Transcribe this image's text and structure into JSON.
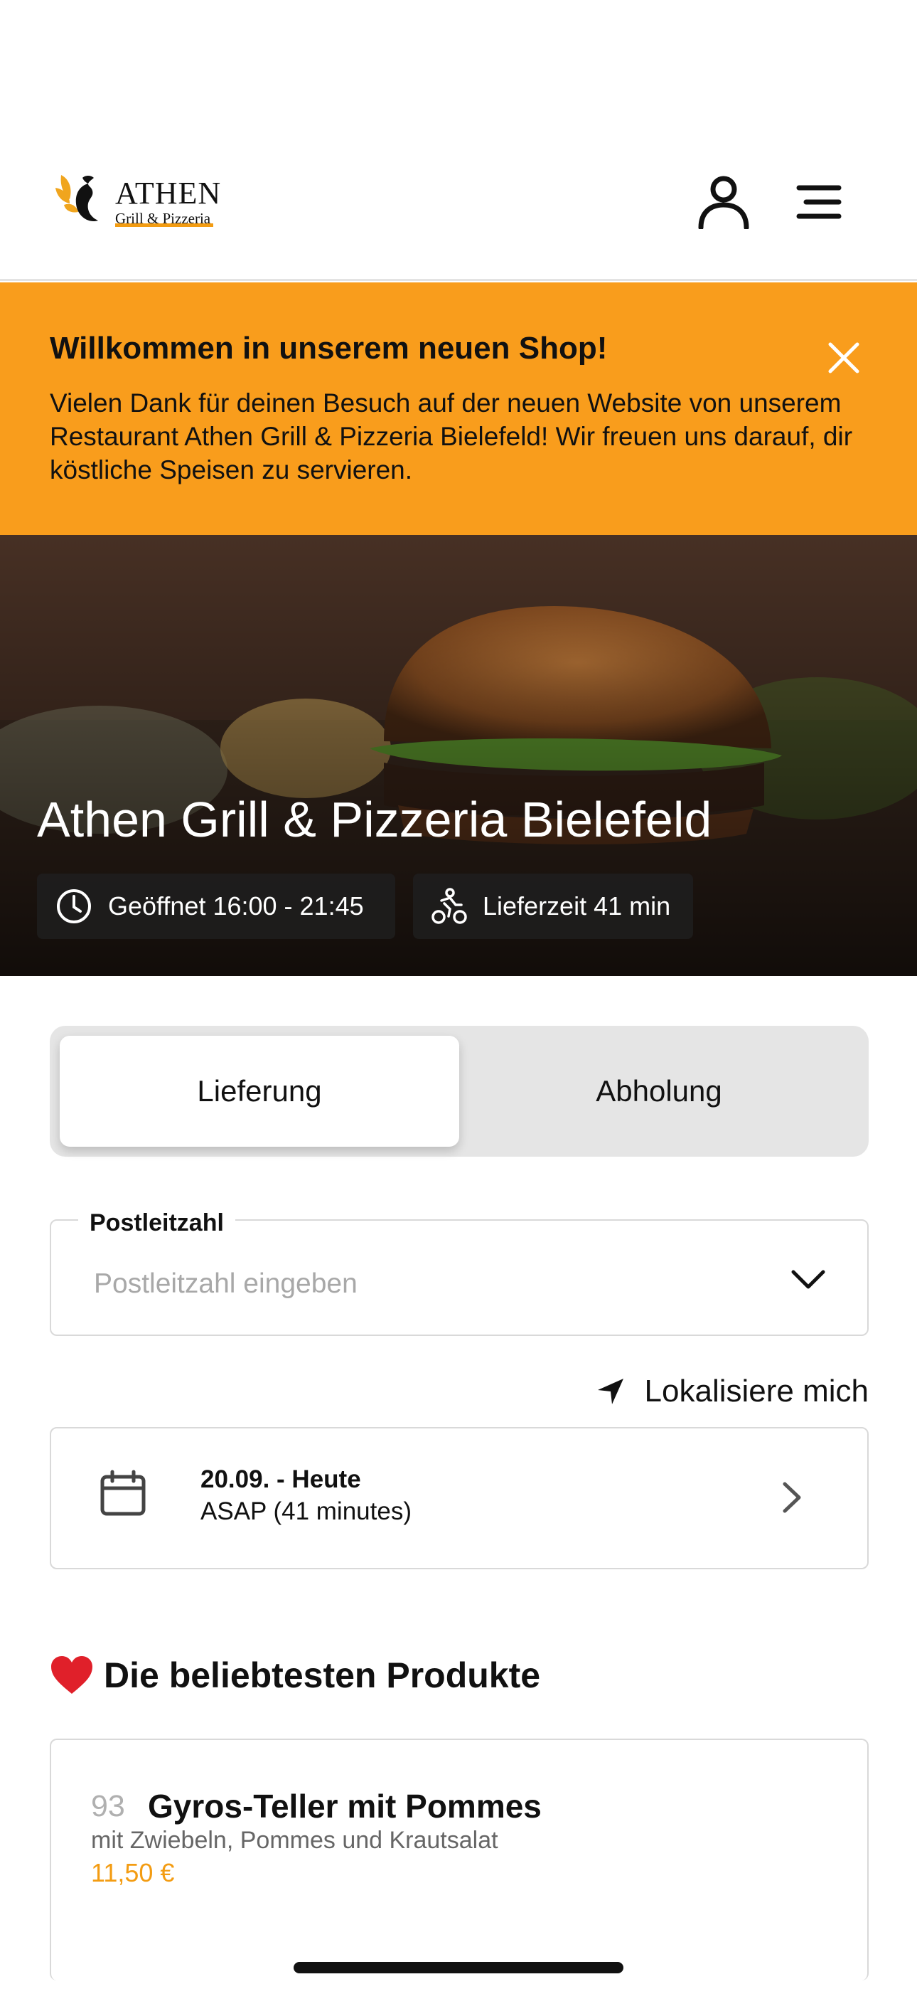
{
  "header": {
    "logo": {
      "main": "ATHEN",
      "sub": "Grill & Pizzeria"
    },
    "icons": {
      "account": "user-icon",
      "menu": "hamburger-menu-icon"
    }
  },
  "banner": {
    "title": "Willkommen in unserem neuen Shop!",
    "text": "Vielen Dank für deinen Besuch auf der neuen Website von unserem Restaurant Athen Grill & Pizzeria Bielefeld! Wir freuen uns darauf, dir köstliche Speisen zu servieren.",
    "background": "#f99d1c"
  },
  "hero": {
    "title": "Athen Grill & Pizzeria Bielefeld",
    "opening": "Geöffnet 16:00 - 21:45",
    "delivery_time": "Lieferzeit 41 min"
  },
  "order_mode": {
    "options": [
      "Lieferung",
      "Abholung"
    ],
    "selected": "Lieferung"
  },
  "zip": {
    "label": "Postleitzahl",
    "placeholder": "Postleitzahl eingeben",
    "value": ""
  },
  "locate": {
    "label": "Lokalisiere mich"
  },
  "schedule": {
    "date": "20.09. - Heute",
    "time": "ASAP (41 minutes)"
  },
  "popular": {
    "title": "Die beliebtesten Produkte",
    "products": [
      {
        "number": "93",
        "name": "Gyros-Teller mit Pommes",
        "description": "mit Zwiebeln, Pommes und Krautsalat",
        "price": "11,50 €"
      }
    ]
  },
  "colors": {
    "accent": "#f39c12",
    "banner": "#f99d1c",
    "text": "#111111"
  }
}
